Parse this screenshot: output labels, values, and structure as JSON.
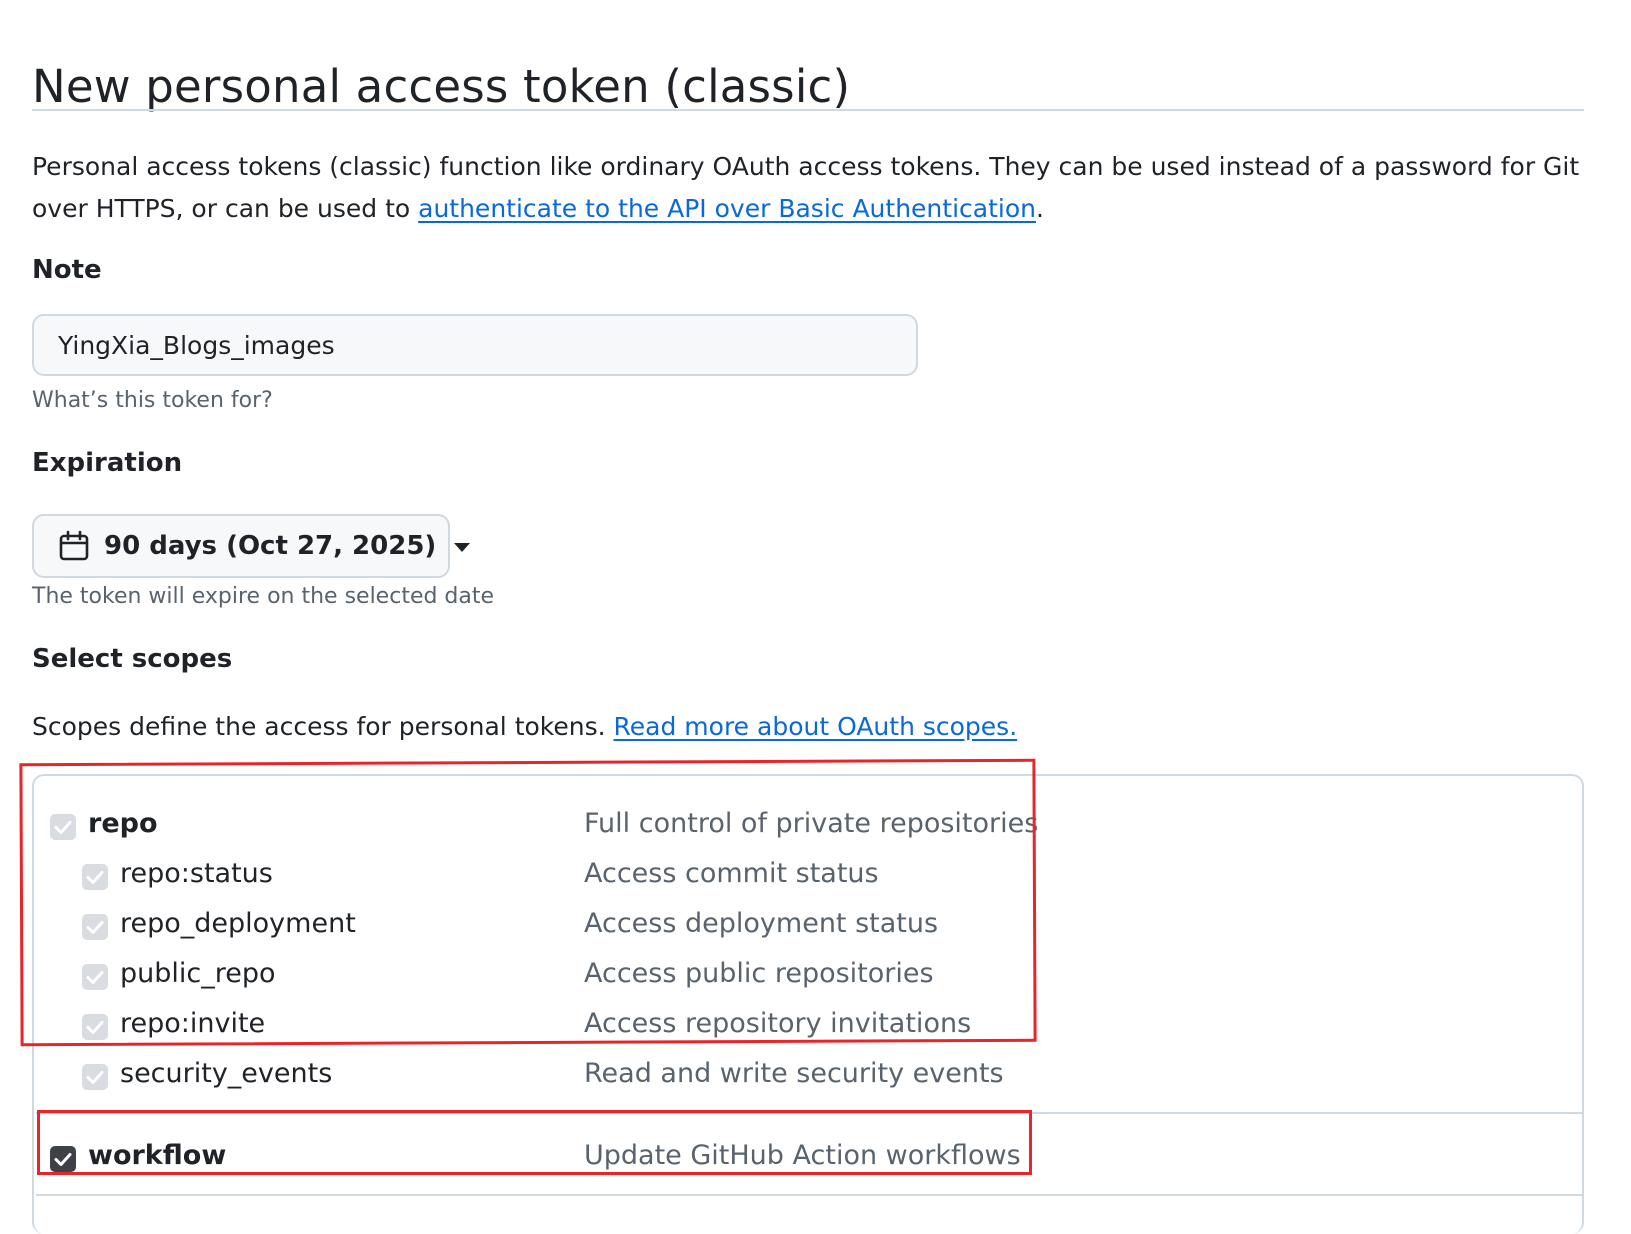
{
  "page": {
    "title": "New personal access token (classic)",
    "intro_text": "Personal access tokens (classic) function like ordinary OAuth access tokens. They can be used instead of a password for Git over HTTPS, or can be used to ",
    "intro_link": "authenticate to the API over Basic Authentication",
    "intro_end": "."
  },
  "note": {
    "label": "Note",
    "value": "YingXia_Blogs_images",
    "hint": "What’s this token for?"
  },
  "expiration": {
    "label": "Expiration",
    "selected": "90 days (Oct 27, 2025)",
    "hint": "The token will expire on the selected date",
    "icon": "calendar-icon"
  },
  "scopes": {
    "label": "Select scopes",
    "description": "Scopes define the access for personal tokens. ",
    "link": "Read more about OAuth scopes.",
    "items": [
      {
        "name": "repo",
        "description": "Full control of private repositories",
        "checked": true,
        "disabled": true,
        "parent": true
      },
      {
        "name": "repo:status",
        "description": "Access commit status",
        "checked": true,
        "disabled": true,
        "parent": false
      },
      {
        "name": "repo_deployment",
        "description": "Access deployment status",
        "checked": true,
        "disabled": true,
        "parent": false
      },
      {
        "name": "public_repo",
        "description": "Access public repositories",
        "checked": true,
        "disabled": true,
        "parent": false
      },
      {
        "name": "repo:invite",
        "description": "Access repository invitations",
        "checked": true,
        "disabled": true,
        "parent": false
      },
      {
        "name": "security_events",
        "description": "Read and write security events",
        "checked": true,
        "disabled": true,
        "parent": false
      },
      {
        "name": "workflow",
        "description": "Update GitHub Action workflows",
        "checked": true,
        "disabled": false,
        "parent": true
      }
    ]
  },
  "colors": {
    "link": "#0969da",
    "annotation": "#e8262a",
    "checkbox_disabled": "#d9dde2",
    "checkbox_active": "#3e4248"
  }
}
